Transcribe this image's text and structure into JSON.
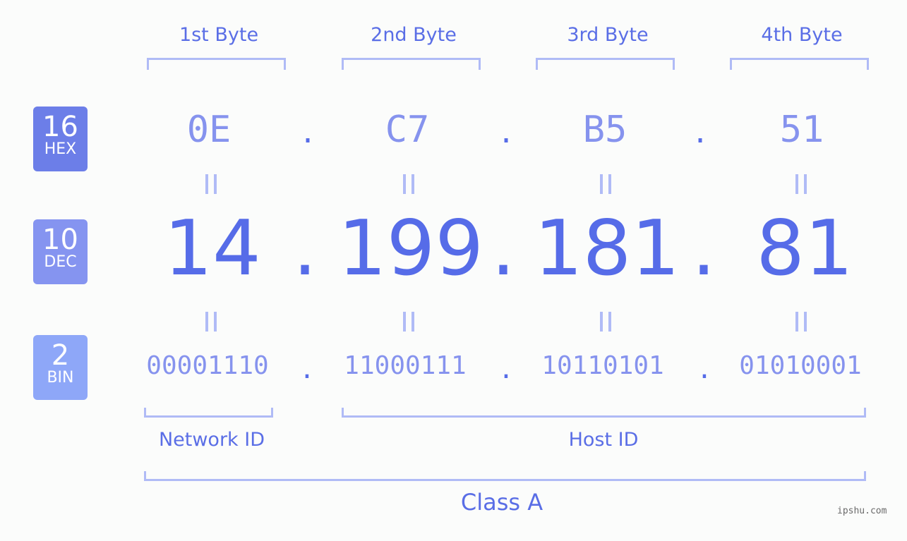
{
  "bytes": [
    {
      "label": "1st Byte",
      "hex": "0E",
      "dec": "14",
      "bin": "00001110"
    },
    {
      "label": "2nd Byte",
      "hex": "C7",
      "dec": "199",
      "bin": "11000111"
    },
    {
      "label": "3rd Byte",
      "hex": "B5",
      "dec": "181",
      "bin": "10110101"
    },
    {
      "label": "4th Byte",
      "hex": "51",
      "dec": "81",
      "bin": "01010001"
    }
  ],
  "separator": ".",
  "equals_icon": "double-vertical-bar",
  "badges": {
    "hex": {
      "num": "16",
      "label": "HEX",
      "color": "#6c7ee8"
    },
    "dec": {
      "num": "10",
      "label": "DEC",
      "color": "#8594f0"
    },
    "bin": {
      "num": "2",
      "label": "BIN",
      "color": "#8ea7f8"
    }
  },
  "network_id_label": "Network ID",
  "host_id_label": "Host ID",
  "class_label": "Class A",
  "watermark": "ipshu.com",
  "colors": {
    "accent": "#566ce8",
    "light": "#8693ee",
    "bracket": "#b0bbf6",
    "background": "#fbfcfb"
  }
}
